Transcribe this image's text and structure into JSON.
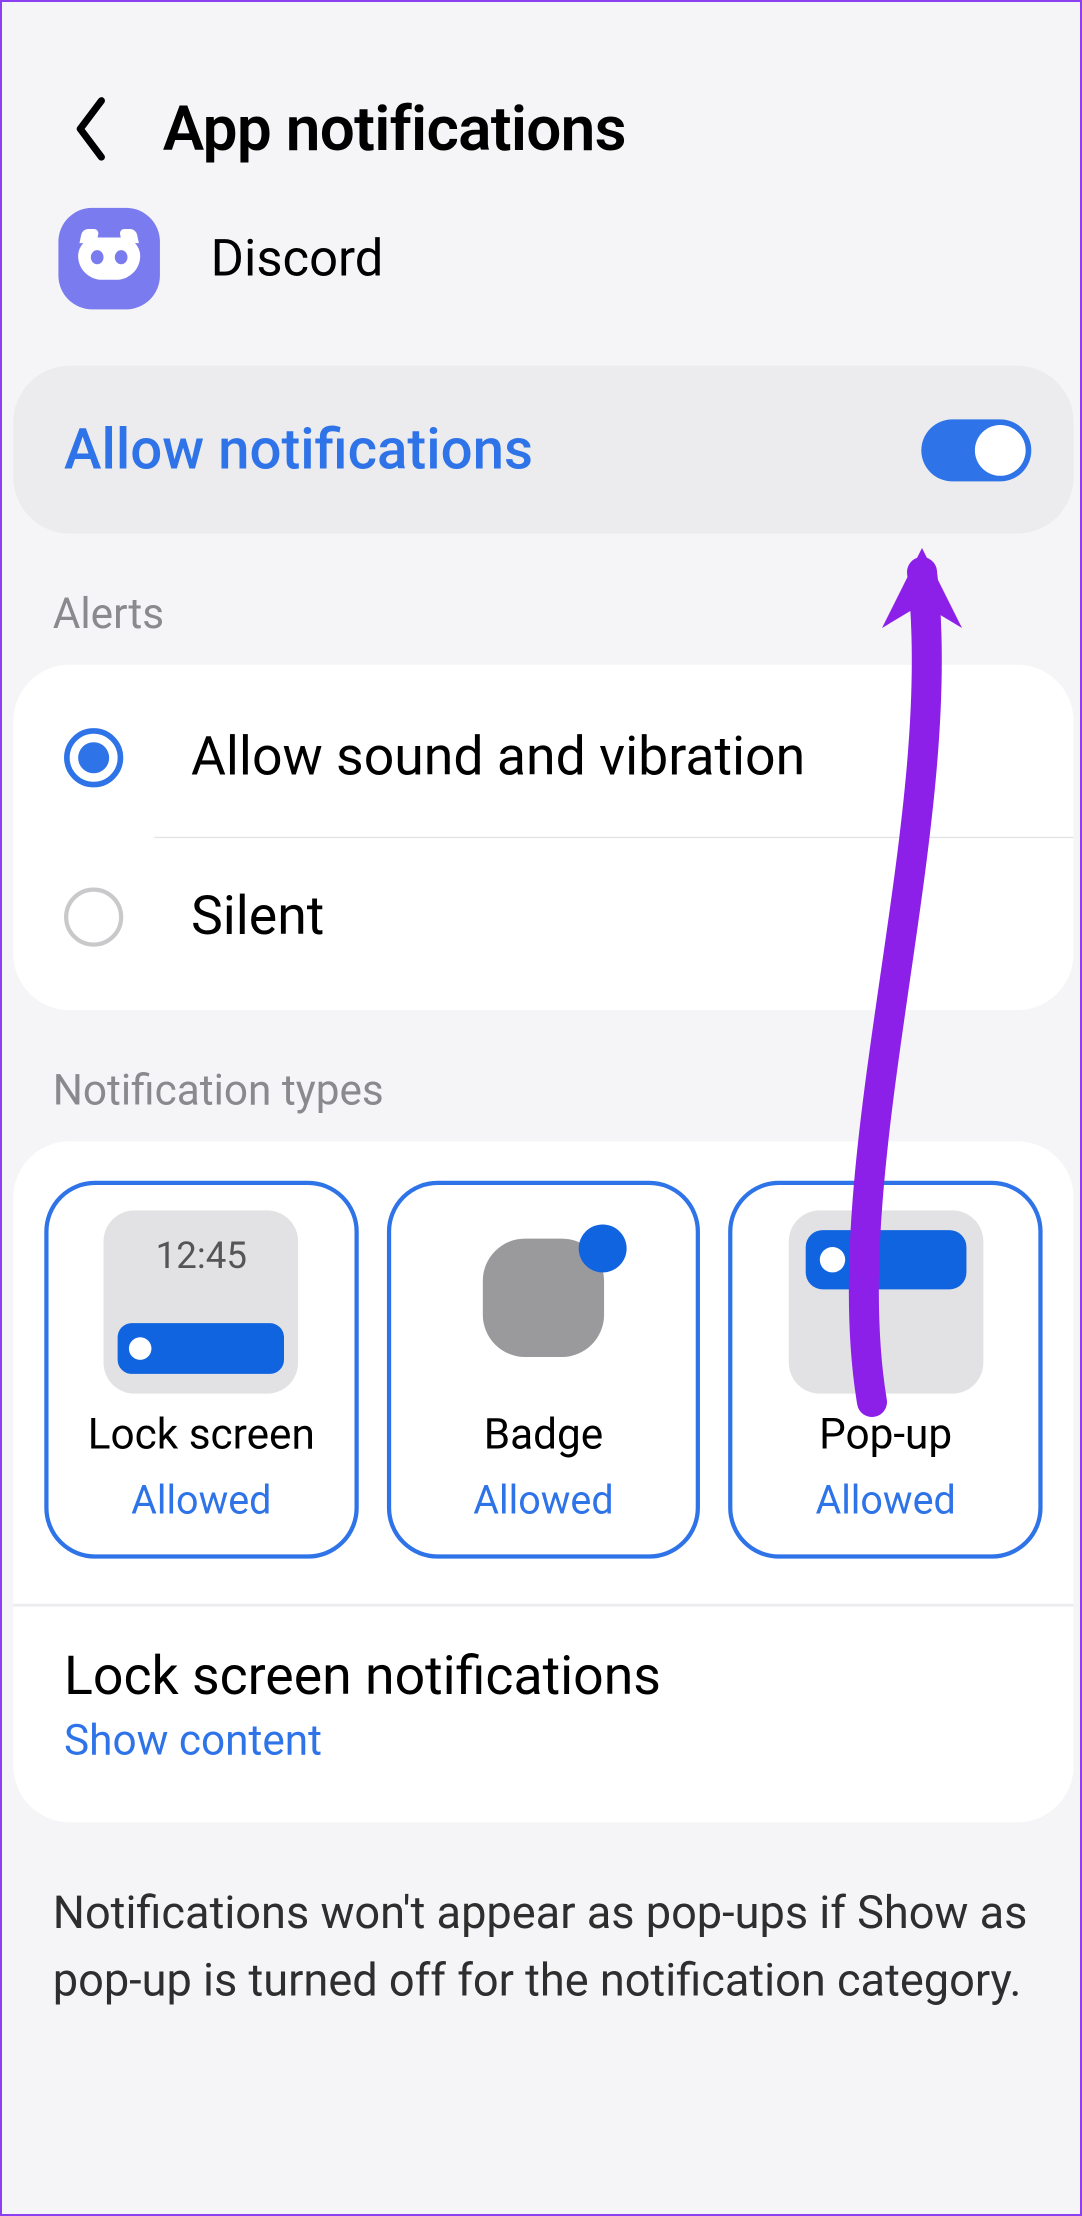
{
  "header": {
    "title": "App notifications"
  },
  "app": {
    "name": "Discord"
  },
  "allow": {
    "label": "Allow notifications",
    "enabled": true
  },
  "sections": {
    "alerts_label": "Alerts",
    "types_label": "Notification types"
  },
  "alerts": {
    "options": [
      {
        "label": "Allow sound and vibration",
        "selected": true
      },
      {
        "label": "Silent",
        "selected": false
      }
    ]
  },
  "types": [
    {
      "title": "Lock screen",
      "status": "Allowed",
      "preview_time": "12:45"
    },
    {
      "title": "Badge",
      "status": "Allowed"
    },
    {
      "title": "Pop-up",
      "status": "Allowed"
    }
  ],
  "lockscreen": {
    "title": "Lock screen notifications",
    "subtitle": "Show content"
  },
  "footer": "Notifications won't appear as pop-ups if Show as pop-up is turned off for the notification category."
}
